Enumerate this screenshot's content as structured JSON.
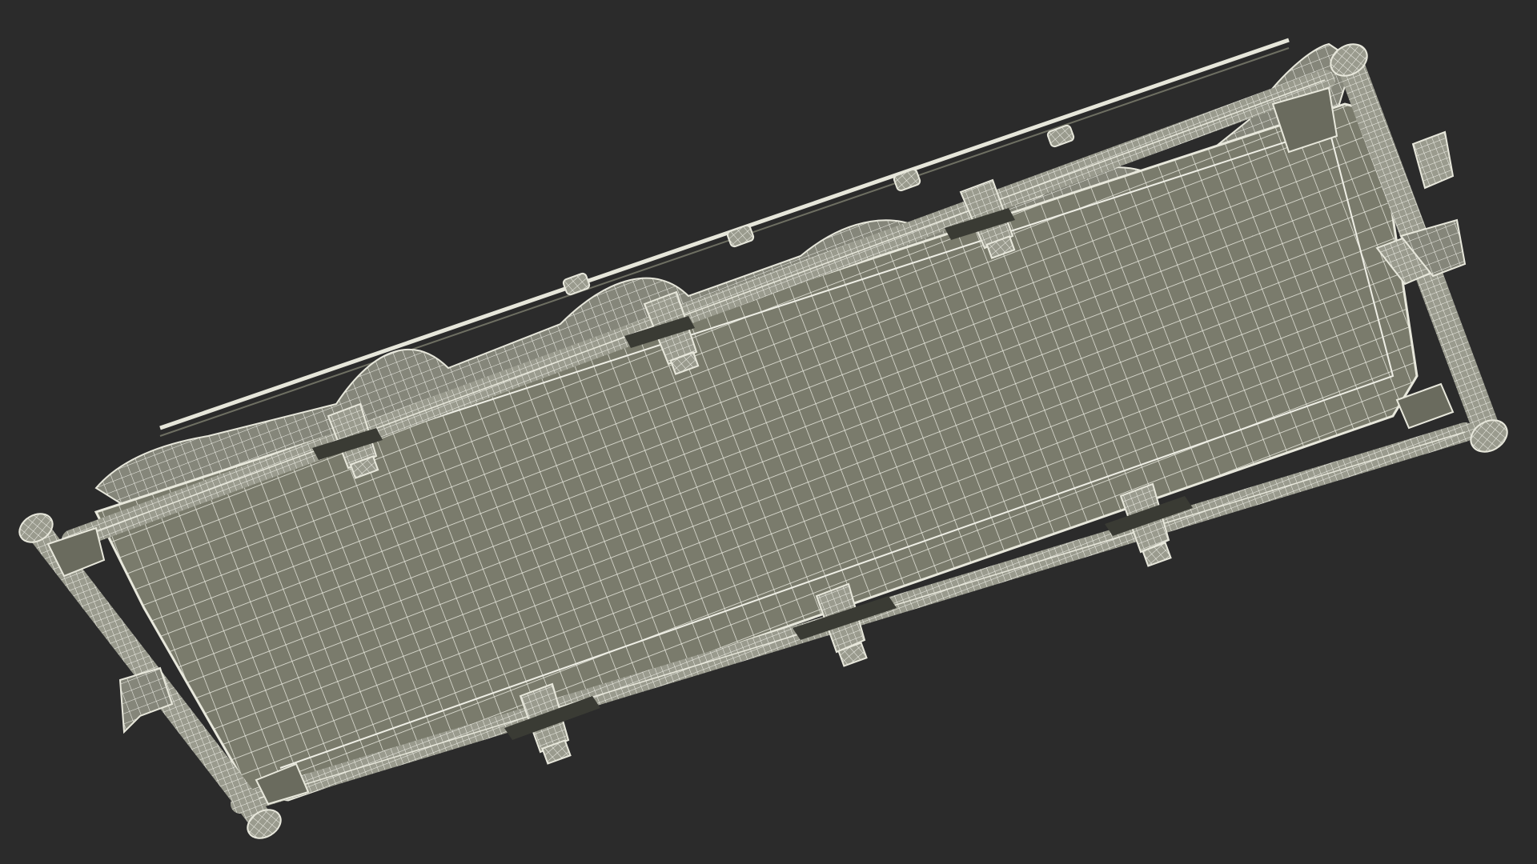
{
  "scene": {
    "subject": "wireframe-stretcher",
    "background_color": "#2b2b2b",
    "mesh_fill_color": "#7a7b6c",
    "mesh_line_color": "#e8e8dc",
    "frame_color": "#8a8b7c"
  }
}
